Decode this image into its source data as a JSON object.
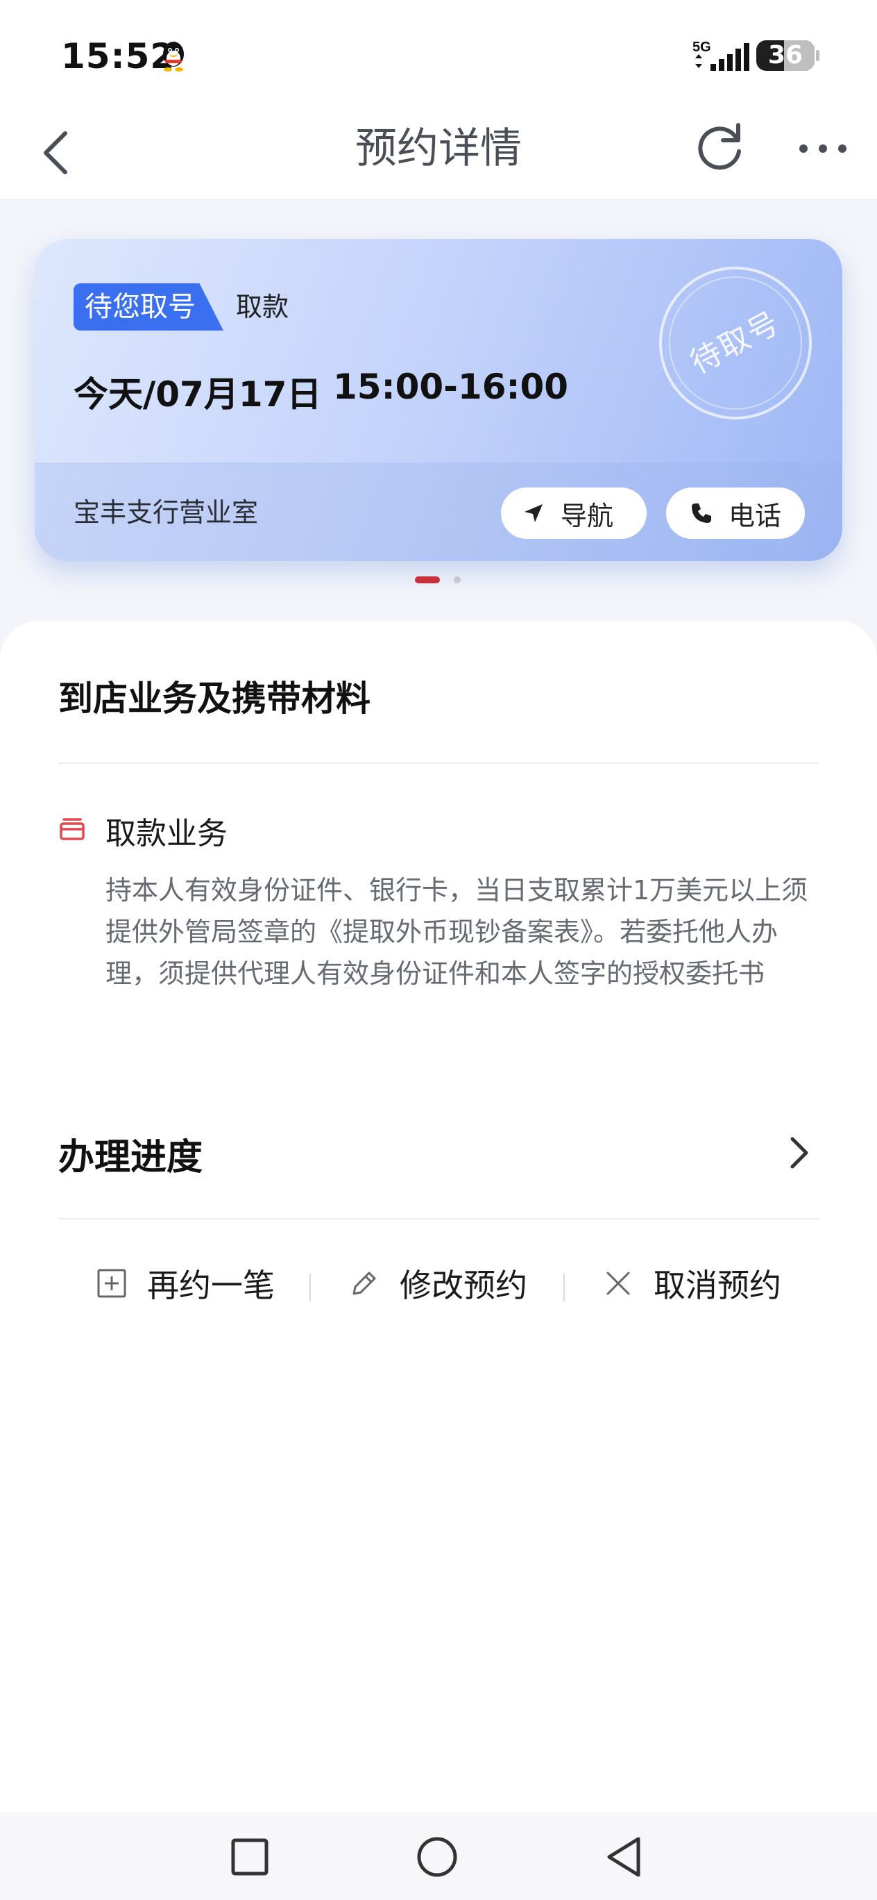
{
  "status_bar": {
    "time": "15:52",
    "network": "5G",
    "battery": "36",
    "icons": [
      "qq-penguin-icon",
      "signal-icon",
      "battery-icon"
    ]
  },
  "nav": {
    "title": "预约详情",
    "icons": [
      "back-chevron-icon",
      "refresh-icon",
      "more-icon"
    ]
  },
  "card": {
    "status_badge": "待您取号",
    "business_type": "取款",
    "date": "今天/07月17日",
    "time_range": "15:00-16:00",
    "stamp": "待取号",
    "branch": "宝丰支行营业室",
    "nav_button": "导航",
    "call_button": "电话",
    "colors": {
      "accent": "#3a6ff0",
      "card_start": "#dde7fd",
      "card_end": "#9db6f5"
    }
  },
  "pager": {
    "total": 2,
    "active": 1,
    "active_color": "#c8303a"
  },
  "materials": {
    "title": "到店业务及携带材料",
    "item_title": "取款业务",
    "item_desc": "持本人有效身份证件、银行卡，当日支取累计1万美元以上须提供外管局签章的《提取外币现钞备案表》。若委托他人办理，须提供代理人有效身份证件和本人签字的授权委托书",
    "item_icon": "wallet-icon",
    "icon_color": "#e0484f"
  },
  "progress": {
    "title": "办理进度"
  },
  "actions": {
    "rebook": "再约一笔",
    "modify": "修改预约",
    "cancel": "取消预约"
  },
  "system_nav": [
    "square-recent-icon",
    "circle-home-icon",
    "triangle-back-icon"
  ]
}
